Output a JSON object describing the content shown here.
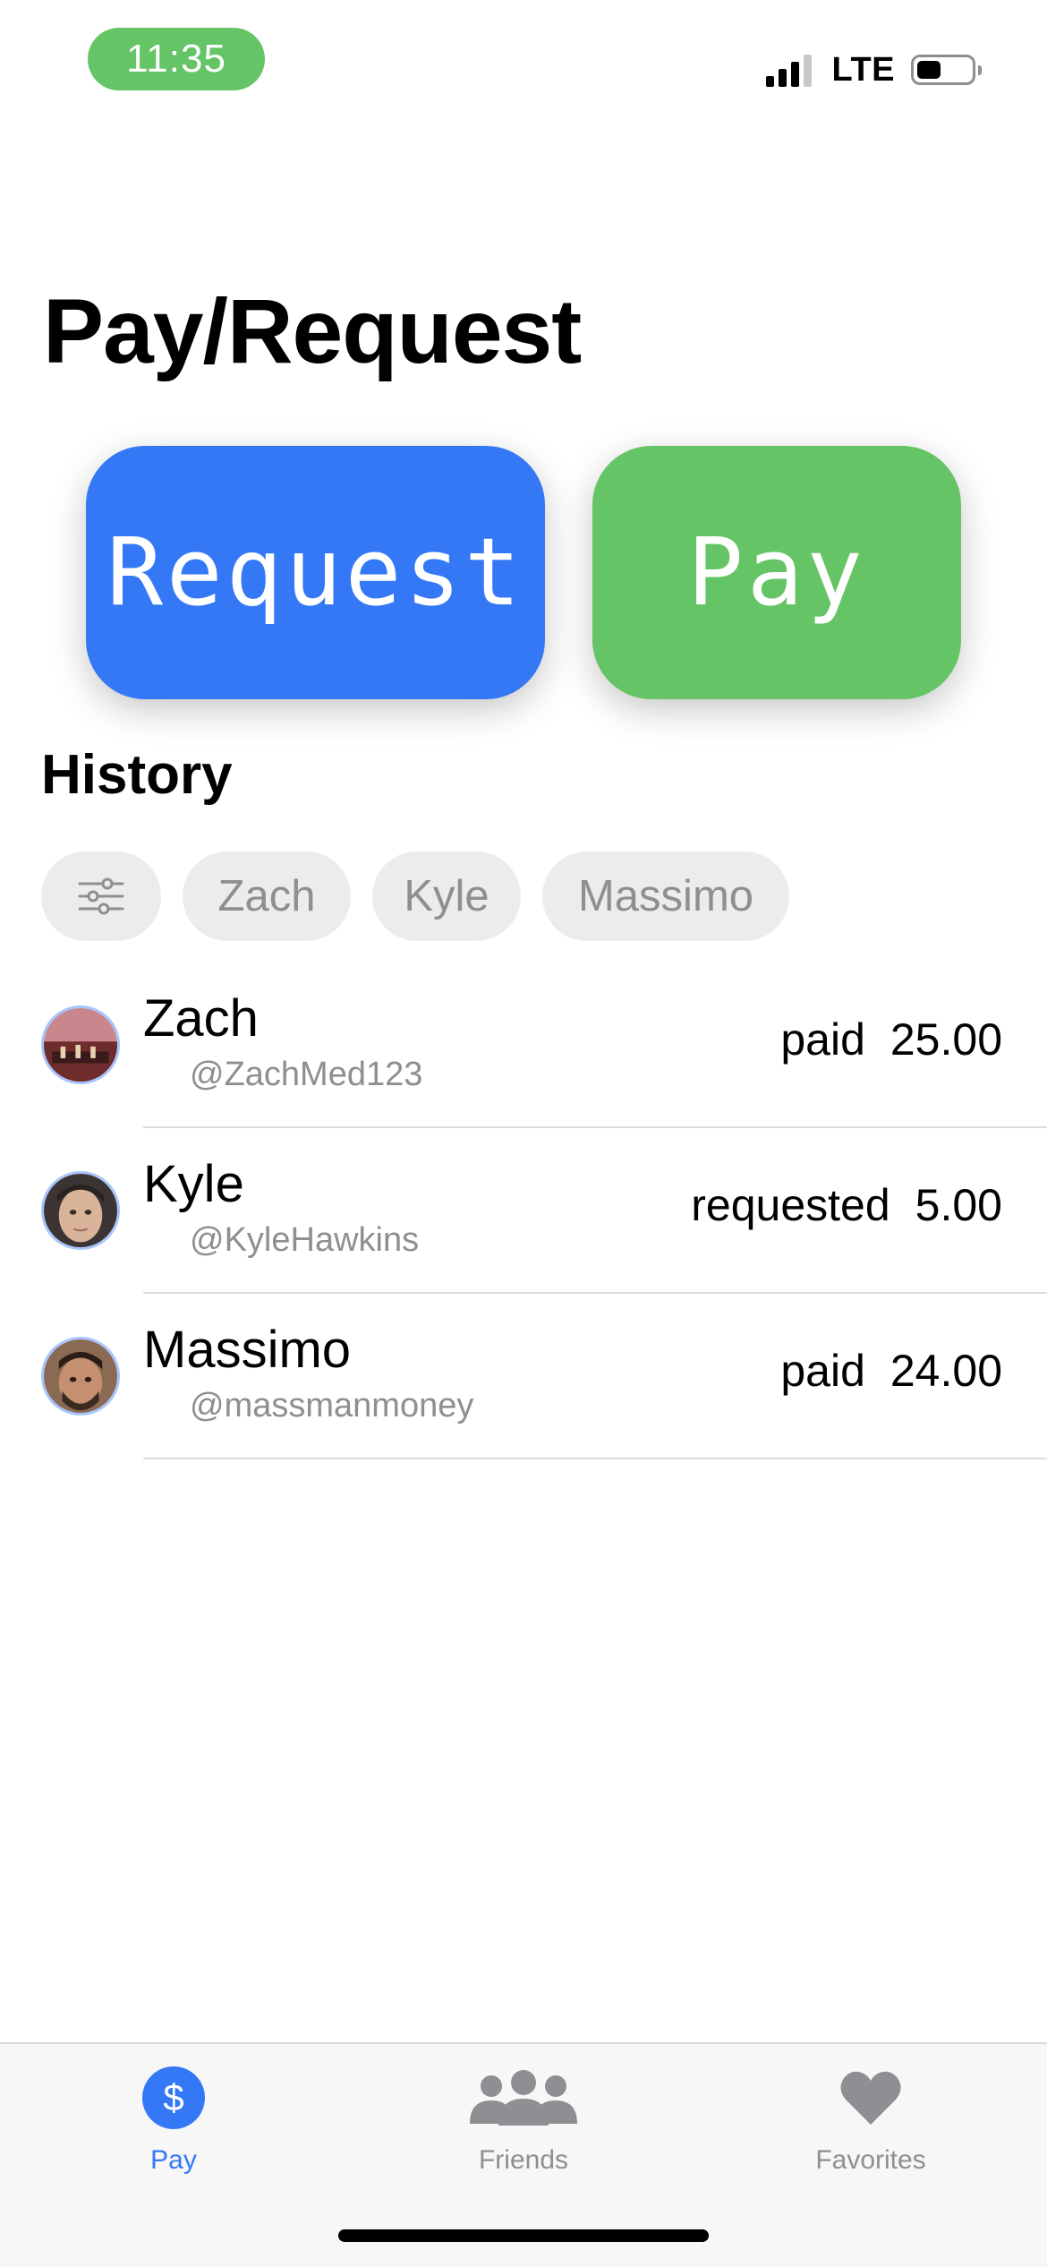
{
  "status_bar": {
    "time": "11:35",
    "network": "LTE",
    "battery_level": 0.45,
    "signal_bars": 3,
    "signal_bars_total": 4,
    "time_pill_color": "#65c466"
  },
  "page": {
    "title": "Pay/Request"
  },
  "actions": {
    "request_label": "Request",
    "pay_label": "Pay",
    "request_color": "#3478f6",
    "pay_color": "#65c466"
  },
  "history": {
    "title": "History",
    "filter_icon": "sliders-icon",
    "filters": [
      "Zach",
      "Kyle",
      "Massimo"
    ],
    "items": [
      {
        "name": "Zach",
        "handle": "@ZachMed123",
        "type": "paid",
        "amount": "25.00",
        "avatar_icon": "avatar-photo-icon"
      },
      {
        "name": "Kyle",
        "handle": "@KyleHawkins",
        "type": "requested",
        "amount": "5.00",
        "avatar_icon": "avatar-photo-icon"
      },
      {
        "name": "Massimo",
        "handle": "@massmanmoney",
        "type": "paid",
        "amount": "24.00",
        "avatar_icon": "avatar-photo-icon"
      }
    ]
  },
  "tab_bar": {
    "active_color": "#3478f6",
    "inactive_color": "#8e8e93",
    "tabs": [
      {
        "label": "Pay",
        "icon": "dollar-icon",
        "active": true
      },
      {
        "label": "Friends",
        "icon": "people-icon",
        "active": false
      },
      {
        "label": "Favorites",
        "icon": "heart-icon",
        "active": false
      }
    ]
  }
}
